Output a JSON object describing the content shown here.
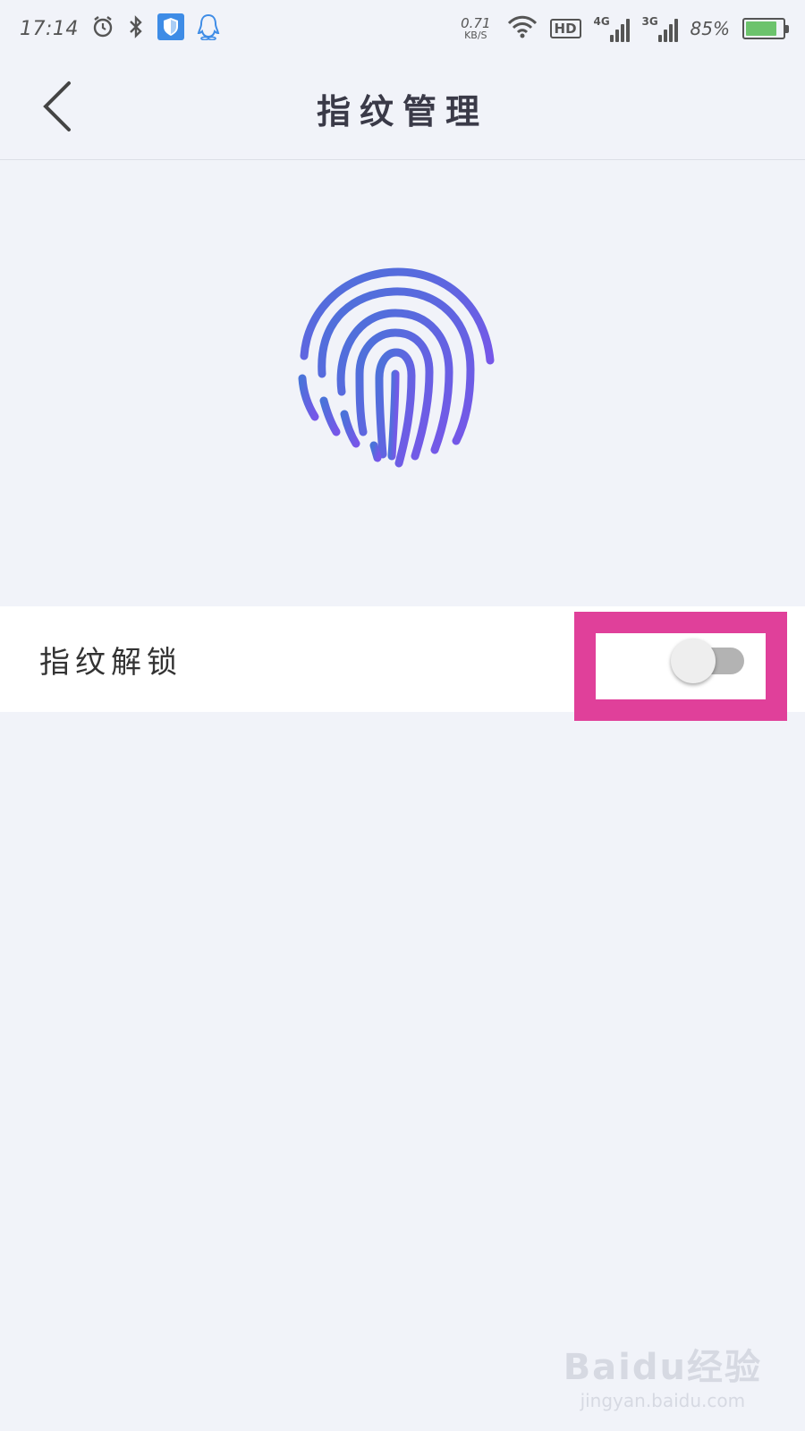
{
  "status_bar": {
    "time": "17:14",
    "net_speed_value": "0.71",
    "net_speed_unit": "KB/S",
    "hd": "HD",
    "signal1_tag": "4G",
    "signal2_tag": "3G",
    "battery_percent": "85%",
    "battery_level": 0.85,
    "icons": [
      "alarm-icon",
      "bluetooth-icon",
      "shield-icon",
      "qq-icon",
      "wifi-icon"
    ]
  },
  "header": {
    "title": "指纹管理",
    "back_icon": "chevron-left-icon"
  },
  "fingerprint": {
    "icon": "fingerprint-icon",
    "gradient_start": "#4a73d9",
    "gradient_end": "#7657e8"
  },
  "settings": {
    "fingerprint_unlock_label": "指纹解锁",
    "fingerprint_unlock_enabled": false
  },
  "highlight_color": "#e0409a",
  "watermark": {
    "logo": "Baidu经验",
    "url": "jingyan.baidu.com"
  }
}
